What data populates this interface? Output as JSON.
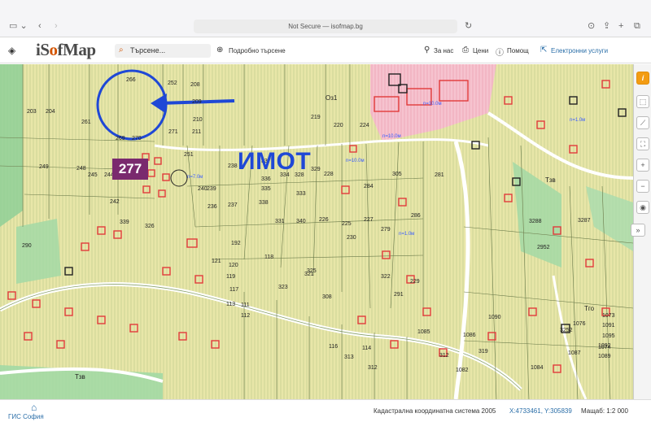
{
  "browser": {
    "address": "Not Secure — isofmap.bg"
  },
  "toolbar": {
    "logo_prefix": "iS",
    "logo_o": "o",
    "logo_suffix": "fMap",
    "search_label": "Търсене...",
    "advanced_search": "Подробно търсене",
    "about": "За нас",
    "prices": "Цени",
    "help": "Помощ",
    "e_services": "Електронни услуги"
  },
  "annotation": {
    "parcel_number": "277",
    "label": "ИМОТ",
    "color": "#1f48d6"
  },
  "map": {
    "parcel_numbers": [
      "266",
      "252",
      "208",
      "203",
      "204",
      "261",
      "269",
      "270",
      "271",
      "210",
      "209",
      "211",
      "219",
      "220",
      "224",
      "249",
      "248",
      "245",
      "244",
      "243",
      "242",
      "239",
      "238",
      "237",
      "236",
      "240",
      "251",
      "337",
      "336",
      "335",
      "338",
      "334",
      "328",
      "333",
      "329",
      "331",
      "340",
      "339",
      "326",
      "325",
      "323",
      "321",
      "322",
      "308",
      "305",
      "279",
      "281",
      "286",
      "284",
      "226",
      "230",
      "225",
      "227",
      "228",
      "229",
      "291",
      "290",
      "192",
      "121",
      "120",
      "119",
      "118",
      "117",
      "113",
      "112",
      "111",
      "114",
      "116",
      "313",
      "312",
      "312",
      "319",
      "1082",
      "1084",
      "1085",
      "1086",
      "1087",
      "1089",
      "1090",
      "1091",
      "1092",
      "1095",
      "1073",
      "1074",
      "1076",
      "3252",
      "3287",
      "3288",
      "2952"
    ],
    "labels": {
      "oz1": "Оз1",
      "tav_left": "Тзв",
      "tav_right": "Тзв",
      "tgo": "Тго"
    },
    "colors": {
      "base": "#e8e6a8",
      "pink_zone": "#f4b6c6",
      "green_zone": "#9fd8a5",
      "building": "#e23b3b",
      "road": "#ffffff",
      "measure": "#2255ff"
    }
  },
  "tools": {
    "info_icon": "i"
  },
  "footer": {
    "gis_logo": "ГИС София",
    "coord_system": "Кадастрална координатна система 2005",
    "coords": "X:4733461, Y:305839",
    "scale": "Мащаб: 1:2 000"
  }
}
